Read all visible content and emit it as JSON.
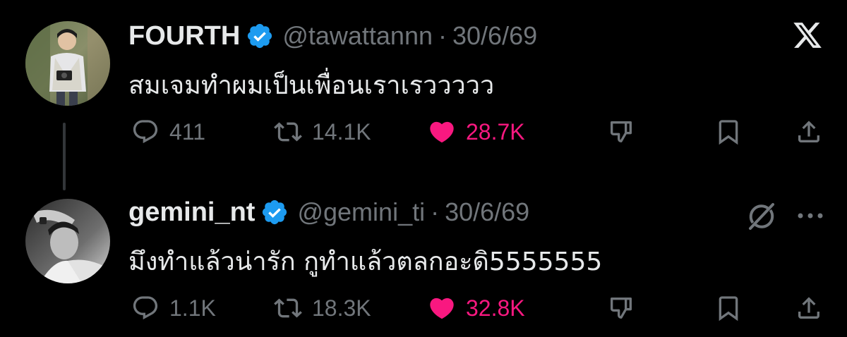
{
  "tweets": [
    {
      "display_name": "FOURTH",
      "verified": true,
      "handle": "@tawattannn",
      "separator": "·",
      "date": "30/6/69",
      "text": "สมเจมทำผมเป็นเพื่อนเราเรววววว",
      "avatar_icon": "avatar-photo-student-with-camera",
      "corner_icon": "x-logo-icon",
      "metrics": {
        "replies": "411",
        "retweets": "14.1K",
        "likes": "28.7K"
      }
    },
    {
      "display_name": "gemini_nt",
      "verified": true,
      "handle": "@gemini_ti",
      "separator": "·",
      "date": "30/6/69",
      "text": "มึงทำแล้วน่ารัก กูทำแล้วตลกอะดิ5555555",
      "avatar_icon": "avatar-photo-black-and-white",
      "corner_icons": [
        "grok-icon",
        "more-options-icon"
      ],
      "metrics": {
        "replies": "1.1K",
        "retweets": "18.3K",
        "likes": "32.8K"
      }
    }
  ],
  "colors": {
    "background": "#000000",
    "primary_text": "#e7e9ea",
    "secondary_text": "#71767b",
    "like_pink": "#f91880",
    "verified_blue": "#1d9bf0",
    "thread_line": "#333639"
  }
}
